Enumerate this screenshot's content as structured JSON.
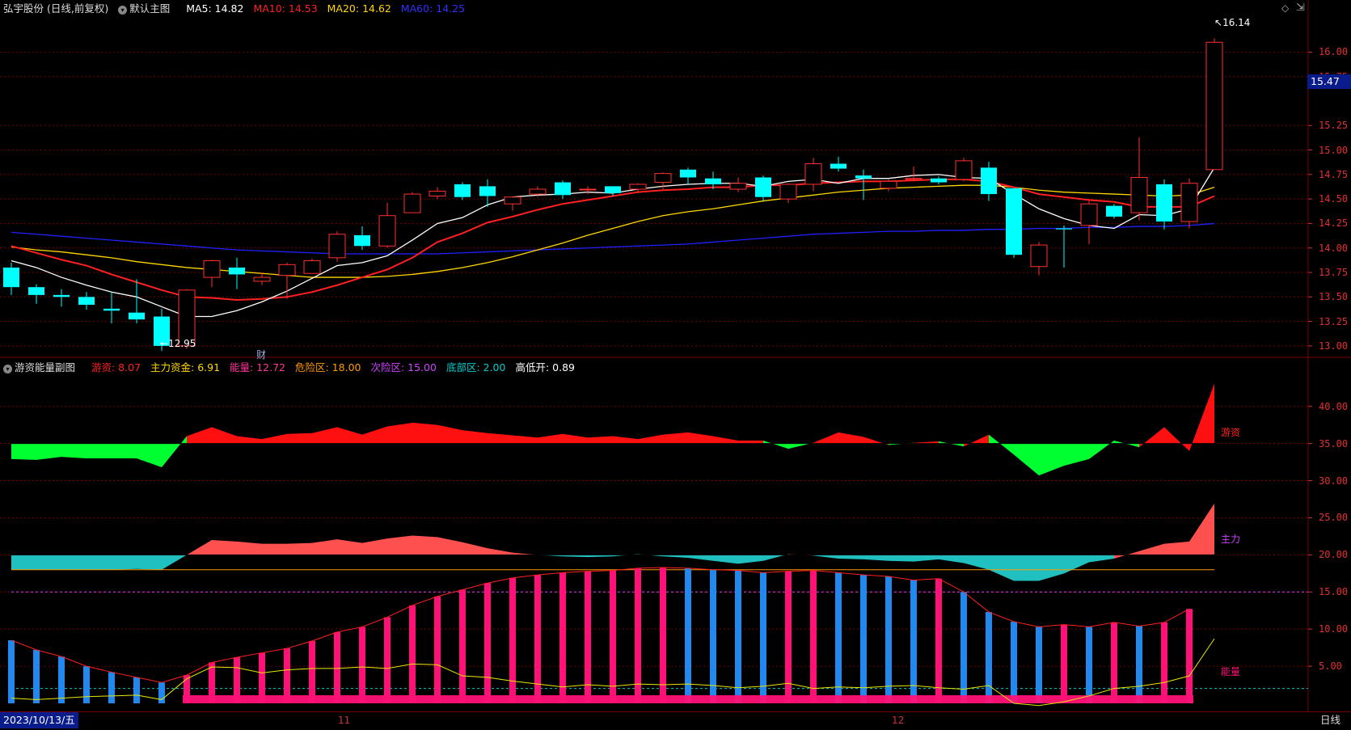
{
  "header": {
    "stock": "弘宇股份 (日线,前复权)",
    "template": "默认主图",
    "ma": [
      {
        "label": "MA5: 14.82",
        "color": "#ffffff"
      },
      {
        "label": "MA10: 14.53",
        "color": "#ff2020"
      },
      {
        "label": "MA20: 14.62",
        "color": "#ffd700"
      },
      {
        "label": "MA60: 14.25",
        "color": "#3030ff"
      }
    ]
  },
  "sub_header": {
    "title": "游资能量副图",
    "items": [
      {
        "label": "游资: 8.07",
        "color": "#ff2020"
      },
      {
        "label": "主力资金: 6.91",
        "color": "#ffd700"
      },
      {
        "label": "能量: 12.72",
        "color": "#ff3399"
      },
      {
        "label": "危险区: 18.00",
        "color": "#ff9900"
      },
      {
        "label": "次险区: 15.00",
        "color": "#d040ff"
      },
      {
        "label": "底部区: 2.00",
        "color": "#00cccc"
      },
      {
        "label": "高低开: 0.89",
        "color": "#ffffff"
      }
    ]
  },
  "price_axis": [
    "16.00",
    "15.75",
    "15.25",
    "15.00",
    "14.75",
    "14.50",
    "14.25",
    "14.00",
    "13.75",
    "13.50",
    "13.25",
    "13.00"
  ],
  "current_price_tag": "15.47",
  "high_marker": "16.14",
  "low_marker": "←12.95",
  "event_marker": "财",
  "sub_axis": [
    "40.00",
    "35.00",
    "30.00",
    "25.00",
    "20.00",
    "15.00",
    "10.00",
    "5.00"
  ],
  "sub_labels": {
    "youzi": "游资",
    "zhuli": "主力",
    "nengliang": "能量"
  },
  "bottom": {
    "date": "2023/10/13/五",
    "month_ticks": [
      "11",
      "12"
    ],
    "timeframe": "日线"
  },
  "colors": {
    "up": "#ff3030",
    "down": "#00ffff",
    "grid": "#7a0000",
    "ma5": "#ffffff",
    "ma10": "#ff2020",
    "ma20": "#ffd700",
    "ma60": "#2020ff",
    "energy_up": "#ff1177",
    "energy_down": "#2288ee"
  },
  "chart_data": {
    "type": "candlestick",
    "candles": [
      {
        "o": 13.8,
        "h": 13.85,
        "c": 13.6,
        "l": 13.52
      },
      {
        "o": 13.6,
        "h": 13.63,
        "c": 13.52,
        "l": 13.43
      },
      {
        "o": 13.52,
        "h": 13.58,
        "c": 13.5,
        "l": 13.4
      },
      {
        "o": 13.5,
        "h": 13.55,
        "c": 13.42,
        "l": 13.37
      },
      {
        "o": 13.38,
        "h": 13.55,
        "c": 13.36,
        "l": 13.23
      },
      {
        "o": 13.34,
        "h": 13.68,
        "c": 13.27,
        "l": 13.23
      },
      {
        "o": 13.3,
        "h": 13.38,
        "c": 13.0,
        "l": 12.95
      },
      {
        "o": 13.0,
        "h": 13.58,
        "c": 13.57,
        "l": 12.97
      },
      {
        "o": 13.7,
        "h": 13.88,
        "c": 13.87,
        "l": 13.6
      },
      {
        "o": 13.8,
        "h": 13.9,
        "c": 13.73,
        "l": 13.58
      },
      {
        "o": 13.66,
        "h": 13.75,
        "c": 13.7,
        "l": 13.62
      },
      {
        "o": 13.72,
        "h": 13.85,
        "c": 13.83,
        "l": 13.48
      },
      {
        "o": 13.74,
        "h": 13.89,
        "c": 13.87,
        "l": 13.74
      },
      {
        "o": 13.9,
        "h": 14.17,
        "c": 14.14,
        "l": 13.86
      },
      {
        "o": 14.13,
        "h": 14.22,
        "c": 14.02,
        "l": 13.98
      },
      {
        "o": 14.02,
        "h": 14.46,
        "c": 14.33,
        "l": 14.0
      },
      {
        "o": 14.36,
        "h": 14.57,
        "c": 14.55,
        "l": 14.36
      },
      {
        "o": 14.53,
        "h": 14.62,
        "c": 14.58,
        "l": 14.5
      },
      {
        "o": 14.65,
        "h": 14.67,
        "c": 14.52,
        "l": 14.49
      },
      {
        "o": 14.63,
        "h": 14.7,
        "c": 14.53,
        "l": 14.42
      },
      {
        "o": 14.45,
        "h": 14.52,
        "c": 14.52,
        "l": 14.38
      },
      {
        "o": 14.55,
        "h": 14.63,
        "c": 14.6,
        "l": 14.52
      },
      {
        "o": 14.67,
        "h": 14.69,
        "c": 14.54,
        "l": 14.5
      },
      {
        "o": 14.6,
        "h": 14.63,
        "c": 14.6,
        "l": 14.55
      },
      {
        "o": 14.63,
        "h": 14.63,
        "c": 14.56,
        "l": 14.53
      },
      {
        "o": 14.6,
        "h": 14.66,
        "c": 14.65,
        "l": 14.56
      },
      {
        "o": 14.67,
        "h": 14.77,
        "c": 14.76,
        "l": 14.6
      },
      {
        "o": 14.8,
        "h": 14.82,
        "c": 14.72,
        "l": 14.65
      },
      {
        "o": 14.71,
        "h": 14.78,
        "c": 14.65,
        "l": 14.6
      },
      {
        "o": 14.6,
        "h": 14.72,
        "c": 14.66,
        "l": 14.57
      },
      {
        "o": 14.72,
        "h": 14.74,
        "c": 14.52,
        "l": 14.47
      },
      {
        "o": 14.5,
        "h": 14.66,
        "c": 14.65,
        "l": 14.46
      },
      {
        "o": 14.65,
        "h": 14.92,
        "c": 14.86,
        "l": 14.58
      },
      {
        "o": 14.86,
        "h": 14.93,
        "c": 14.81,
        "l": 14.78
      },
      {
        "o": 14.74,
        "h": 14.8,
        "c": 14.71,
        "l": 14.49
      },
      {
        "o": 14.61,
        "h": 14.7,
        "c": 14.68,
        "l": 14.58
      },
      {
        "o": 14.7,
        "h": 14.83,
        "c": 14.71,
        "l": 14.68
      },
      {
        "o": 14.71,
        "h": 14.73,
        "c": 14.67,
        "l": 14.65
      },
      {
        "o": 14.7,
        "h": 14.92,
        "c": 14.89,
        "l": 14.68
      },
      {
        "o": 14.82,
        "h": 14.88,
        "c": 14.55,
        "l": 14.48
      },
      {
        "o": 14.61,
        "h": 14.61,
        "c": 13.93,
        "l": 13.9
      },
      {
        "o": 13.81,
        "h": 14.06,
        "c": 14.03,
        "l": 13.72
      },
      {
        "o": 14.2,
        "h": 14.23,
        "c": 14.19,
        "l": 13.8
      },
      {
        "o": 14.23,
        "h": 14.48,
        "c": 14.45,
        "l": 14.04
      },
      {
        "o": 14.43,
        "h": 14.45,
        "c": 14.32,
        "l": 14.3
      },
      {
        "o": 14.36,
        "h": 15.13,
        "c": 14.72,
        "l": 14.28
      },
      {
        "o": 14.65,
        "h": 14.7,
        "c": 14.27,
        "l": 14.19
      },
      {
        "o": 14.27,
        "h": 14.71,
        "c": 14.66,
        "l": 14.2
      },
      {
        "o": 14.8,
        "h": 16.14,
        "c": 16.1,
        "l": 14.8
      }
    ],
    "ma5": [
      13.87,
      13.8,
      13.7,
      13.62,
      13.55,
      13.5,
      13.4,
      13.3,
      13.3,
      13.36,
      13.45,
      13.56,
      13.69,
      13.82,
      13.85,
      13.92,
      14.08,
      14.25,
      14.31,
      14.44,
      14.52,
      14.54,
      14.55,
      14.57,
      14.56,
      14.6,
      14.63,
      14.65,
      14.66,
      14.66,
      14.63,
      14.68,
      14.7,
      14.66,
      14.71,
      14.71,
      14.74,
      14.75,
      14.72,
      14.71,
      14.55,
      14.4,
      14.3,
      14.23,
      14.2,
      14.34,
      14.33,
      14.4,
      14.82
    ],
    "ma10": [
      14.02,
      13.95,
      13.88,
      13.82,
      13.73,
      13.65,
      13.57,
      13.5,
      13.49,
      13.47,
      13.48,
      13.5,
      13.55,
      13.62,
      13.7,
      13.78,
      13.9,
      14.06,
      14.15,
      14.26,
      14.32,
      14.39,
      14.45,
      14.49,
      14.53,
      14.57,
      14.59,
      14.6,
      14.62,
      14.62,
      14.64,
      14.64,
      14.66,
      14.67,
      14.68,
      14.68,
      14.69,
      14.7,
      14.7,
      14.68,
      14.62,
      14.55,
      14.52,
      14.49,
      14.47,
      14.42,
      14.42,
      14.42,
      14.53
    ],
    "ma20": [
      14.01,
      13.98,
      13.96,
      13.93,
      13.9,
      13.86,
      13.83,
      13.8,
      13.78,
      13.76,
      13.74,
      13.72,
      13.7,
      13.7,
      13.7,
      13.71,
      13.73,
      13.76,
      13.8,
      13.85,
      13.91,
      13.98,
      14.05,
      14.13,
      14.2,
      14.27,
      14.33,
      14.37,
      14.4,
      14.44,
      14.48,
      14.51,
      14.54,
      14.57,
      14.59,
      14.61,
      14.62,
      14.63,
      14.64,
      14.64,
      14.62,
      14.59,
      14.57,
      14.56,
      14.55,
      14.54,
      14.53,
      14.54,
      14.62
    ],
    "ma60": [
      14.16,
      14.14,
      14.12,
      14.1,
      14.08,
      14.06,
      14.04,
      14.02,
      14.0,
      13.98,
      13.97,
      13.96,
      13.95,
      13.94,
      13.94,
      13.94,
      13.94,
      13.94,
      13.95,
      13.96,
      13.97,
      13.98,
      13.99,
      14.0,
      14.01,
      14.02,
      14.03,
      14.04,
      14.06,
      14.08,
      14.1,
      14.12,
      14.14,
      14.15,
      14.16,
      14.17,
      14.17,
      14.18,
      14.18,
      14.19,
      14.19,
      14.2,
      14.2,
      14.21,
      14.21,
      14.22,
      14.22,
      14.23,
      14.25
    ],
    "youzi": [
      -2.1,
      -2.2,
      -1.8,
      -2.0,
      -2.0,
      -2.0,
      -3.2,
      1.0,
      2.2,
      1.0,
      0.6,
      1.3,
      1.4,
      2.2,
      1.2,
      2.3,
      2.8,
      2.5,
      1.8,
      1.4,
      1.1,
      0.8,
      1.3,
      0.8,
      1.0,
      0.6,
      1.2,
      1.5,
      1.0,
      0.4,
      0.4,
      -0.7,
      0.1,
      1.5,
      0.9,
      -0.2,
      0.1,
      0.3,
      -0.4,
      1.2,
      -1.5,
      -4.3,
      -3.0,
      -2.1,
      0.4,
      -0.5,
      2.2,
      -1.0,
      8.07
    ],
    "zhuli": [
      -2.0,
      -2.0,
      -2.0,
      -2.0,
      -2.0,
      -1.9,
      -2.0,
      0.0,
      2.0,
      1.8,
      1.5,
      1.5,
      1.6,
      2.1,
      1.6,
      2.2,
      2.6,
      2.4,
      1.7,
      0.9,
      0.3,
      0.0,
      -0.2,
      -0.3,
      -0.2,
      0.1,
      -0.2,
      -0.4,
      -0.8,
      -1.2,
      -0.8,
      0.1,
      -0.1,
      -0.5,
      -0.6,
      -0.8,
      -0.9,
      -0.6,
      -1.1,
      -2.0,
      -3.5,
      -3.5,
      -2.5,
      -1.0,
      -0.5,
      0.5,
      1.5,
      1.8,
      6.91
    ],
    "nengliang": [
      8.5,
      7.2,
      6.3,
      5.0,
      4.2,
      3.5,
      2.8,
      3.8,
      5.5,
      6.2,
      6.8,
      7.4,
      8.4,
      9.6,
      10.3,
      11.6,
      13.2,
      14.4,
      15.3,
      16.2,
      16.9,
      17.3,
      17.6,
      17.8,
      17.9,
      18.2,
      18.3,
      18.2,
      18.0,
      17.9,
      17.6,
      17.8,
      17.9,
      17.6,
      17.3,
      17.1,
      16.6,
      16.8,
      15.0,
      12.3,
      11.0,
      10.3,
      10.6,
      10.3,
      10.9,
      10.4,
      10.9,
      12.72
    ],
    "gaodikai": [
      -1.8,
      -2.0,
      -1.8,
      -1.6,
      -1.5,
      -1.4,
      -2.0,
      0.8,
      2.4,
      2.3,
      1.6,
      2.0,
      2.2,
      2.2,
      2.4,
      2.2,
      2.8,
      2.7,
      1.2,
      1.0,
      0.5,
      0.1,
      -0.3,
      0.0,
      -0.2,
      0.1,
      0.0,
      0.1,
      -0.1,
      -0.4,
      -0.2,
      0.2,
      -0.5,
      -0.3,
      -0.4,
      -0.2,
      -0.1,
      -0.4,
      -0.6,
      -0.1,
      -2.5,
      -2.8,
      -2.3,
      -1.5,
      -0.5,
      -0.2,
      0.3,
      1.2,
      6.2
    ],
    "zones": {
      "danger": 18.0,
      "second": 15.0,
      "bottom": 2.0
    },
    "price_ylim": [
      12.9,
      16.35
    ],
    "sub_ylim": [
      0,
      44
    ]
  }
}
